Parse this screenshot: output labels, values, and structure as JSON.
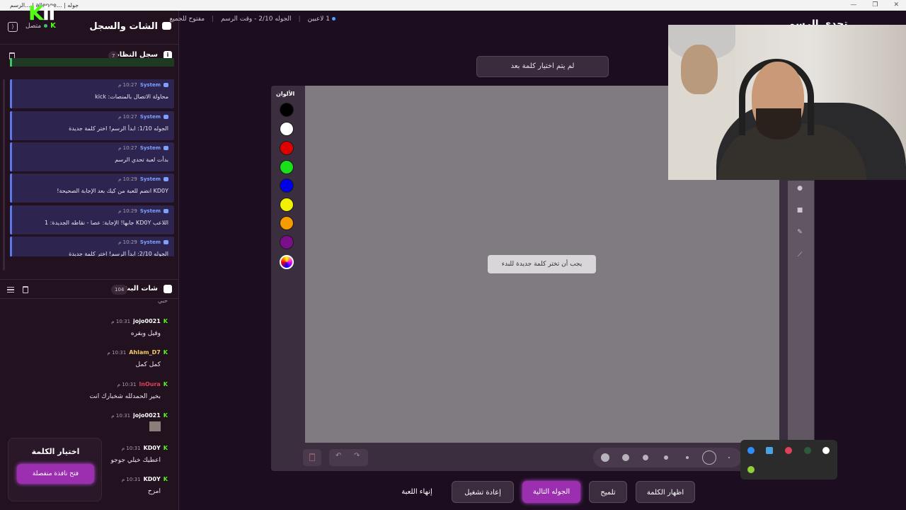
{
  "window": {
    "title": "جوله | ...allenge | ...الرسم",
    "controls": [
      "—",
      "❐",
      "✕"
    ]
  },
  "sidebar": {
    "title": "الشات والسجل",
    "status": "متصل",
    "system_log": {
      "title": "سجل النظام",
      "count": "7",
      "icon": "i",
      "items": [
        {
          "author": "System",
          "time": "10:27 م",
          "text": "محاولة الاتصال بالمنصات: kick"
        },
        {
          "author": "System",
          "time": "10:27 م",
          "text": "الجوله 1/10: ابدأ الرسم! اختر كلمة جديدة"
        },
        {
          "author": "System",
          "time": "10:27 م",
          "text": "بدأت لعبة تحدي الرسم"
        },
        {
          "author": "System",
          "time": "10:29 م",
          "text": "KD0Y انضم للعبة من كيك بعد الإجابة الصحيحة!"
        },
        {
          "author": "System",
          "time": "10:29 م",
          "text": "اللاعب KD0Y جابها! الإجابة: عصا - نقاطه الجديدة: 1"
        },
        {
          "author": "System",
          "time": "10:29 م",
          "text": "الجوله 2/10: ابدأ الرسم! اختر كلمة جديدة"
        }
      ]
    },
    "chat": {
      "title": "شات البث",
      "count": "104",
      "partial_top": "حبي",
      "messages": [
        {
          "user": "jojo0021",
          "time": "10:31 م",
          "text": "وقيل وبقره",
          "color": "#ffffff"
        },
        {
          "user": "Ahlam_D7",
          "time": "10:31 م",
          "text": "كمل كمل",
          "color": "#f3c96b"
        },
        {
          "user": "lnOura",
          "time": "10:31 م",
          "text": "بخير الحمدلله شخبارك انت",
          "color": "#e0405a"
        },
        {
          "user": "jojo0021",
          "time": "10:31 م",
          "text": "",
          "color": "#ffffff"
        },
        {
          "user": "KD0Y",
          "time": "10:31 م",
          "text": "اعطيك خيلي جوجو",
          "color": "#ffffff"
        },
        {
          "user": "KD0Y",
          "time": "10:31 م",
          "text": "امزح",
          "color": "#ffffff"
        }
      ]
    },
    "word_pick": {
      "title": "اختيار الكلمة",
      "button": "فتح نافذة منفصلة"
    }
  },
  "header": {
    "players": "1 لاعبين",
    "round": "الجوله 2/10 - وقت الرسم",
    "mode": "مفتوح للجميع",
    "title": "تحدي الرسم"
  },
  "board": {
    "prompt": "لم يتم اختيار كلمة بعد",
    "colors_label": "الألوان",
    "colors": [
      "#000000",
      "#ffffff",
      "#e00000",
      "#19e019",
      "#0000e6",
      "#f2f200",
      "#f59b00",
      "#7a0f8a",
      "multi"
    ],
    "canvas_message": "يجب أن تختر كلمة جديدة للبدء",
    "tools": [
      "●",
      "■",
      "✎",
      "⟋"
    ]
  },
  "controls": {
    "reveal": "اظهار الكلمة",
    "hint": "تلميح",
    "next": "الجوله التالية",
    "restart": "إعادة تشغيل",
    "end": "إنهاء اللعبة"
  }
}
